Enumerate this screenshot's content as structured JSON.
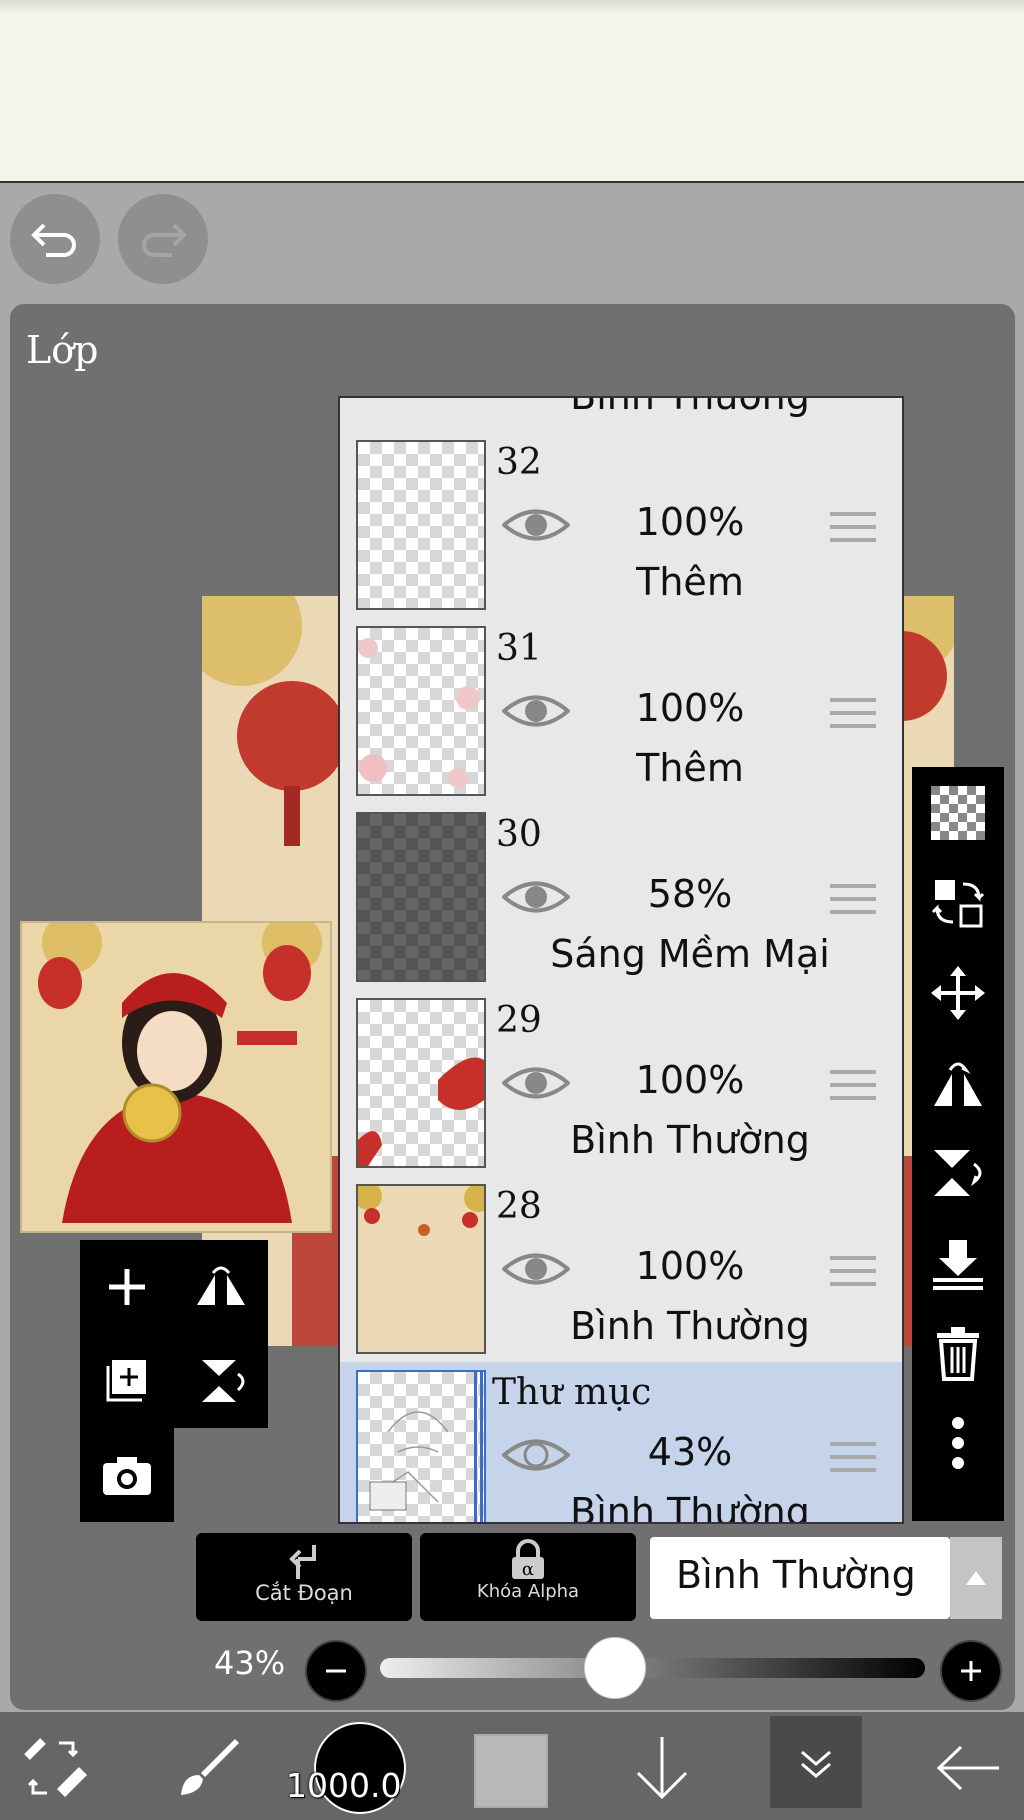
{
  "app": {
    "panel_title": "Lớp"
  },
  "layers": [
    {
      "name": "32",
      "opacity": "100%",
      "blend": "Thêm",
      "visible": true,
      "selected": false
    },
    {
      "name": "31",
      "opacity": "100%",
      "blend": "Thêm",
      "visible": true,
      "selected": false
    },
    {
      "name": "30",
      "opacity": "58%",
      "blend": "Sáng Mềm Mại",
      "visible": true,
      "selected": false
    },
    {
      "name": "29",
      "opacity": "100%",
      "blend": "Bình Thường",
      "visible": true,
      "selected": false
    },
    {
      "name": "28",
      "opacity": "100%",
      "blend": "Bình Thường",
      "visible": true,
      "selected": false
    },
    {
      "name": "Thư mục",
      "opacity": "43%",
      "blend": "Bình Thường",
      "visible": true,
      "selected": true
    }
  ],
  "partial_top_layer": {
    "blend": "Bình Thường"
  },
  "layer_controls": {
    "clip_label": "Cắt Đoạn",
    "alpha_lock_label": "Khóa Alpha",
    "blend_mode": "Bình Thường",
    "opacity_label": "43%",
    "opacity_value": 0.43
  },
  "bottom_toolbar": {
    "brush_size": "1000.0"
  },
  "icons": {
    "undo": "undo-icon",
    "redo": "redo-icon",
    "add_layer": "plus-icon",
    "flip_h": "flip-horizontal-icon",
    "add_image": "add-layer-icon",
    "flip_v": "flip-vertical-icon",
    "camera": "camera-icon",
    "transparent": "checker-icon",
    "swap": "swap-icon",
    "move": "move-icon",
    "merge_down": "merge-down-icon",
    "delete": "trash-icon",
    "more": "more-icon"
  }
}
